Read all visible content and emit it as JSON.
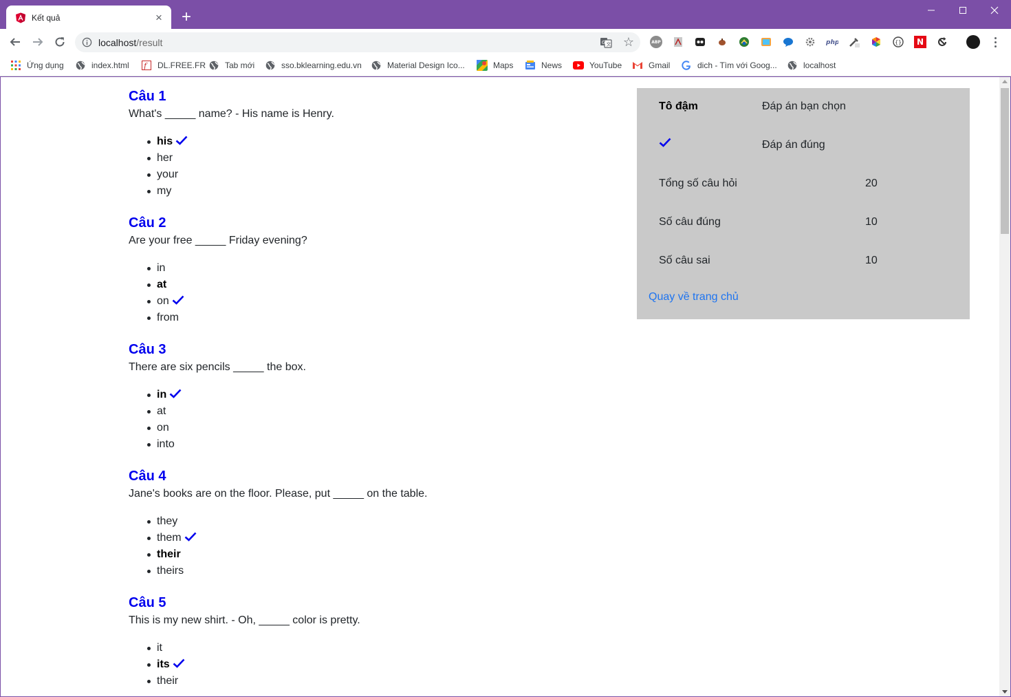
{
  "browser": {
    "tab_title": "Kết quả",
    "url_host": "localhost",
    "url_path": "/result",
    "new_tab_symbol": "+",
    "tab_close_symbol": "×"
  },
  "toolbar_icons": [
    "back-icon",
    "forward-icon",
    "reload-icon",
    "info-icon",
    "translate-icon",
    "star-icon",
    "adblock-icon",
    "pdf-icon",
    "ext-dark-icon",
    "ext-acorn-icon",
    "ext-green-icon",
    "ext-picture-icon",
    "chat-bubble-icon",
    "ext-gear-icon",
    "php-icon",
    "eyedropper-icon",
    "color-wheel-icon",
    "ext-code-icon",
    "ext-n-icon",
    "ext-sync-icon",
    "avatar-icon",
    "menu-icon"
  ],
  "bookmarks": [
    {
      "label": "Ứng dụng",
      "icon": "apps-grid-icon"
    },
    {
      "label": "index.html",
      "icon": "globe-icon"
    },
    {
      "label": "DL.FREE.FR",
      "icon": "flash-icon"
    },
    {
      "label": "Tab mới",
      "icon": "globe-icon"
    },
    {
      "label": "sso.bklearning.edu.vn",
      "icon": "globe-icon"
    },
    {
      "label": "Material Design Ico...",
      "icon": "globe-icon"
    },
    {
      "label": "Maps",
      "icon": "maps-icon"
    },
    {
      "label": "News",
      "icon": "news-icon"
    },
    {
      "label": "YouTube",
      "icon": "youtube-icon"
    },
    {
      "label": "Gmail",
      "icon": "gmail-icon"
    },
    {
      "label": "dich - Tìm với Goog...",
      "icon": "google-icon"
    },
    {
      "label": "localhost",
      "icon": "globe-icon"
    }
  ],
  "questions": [
    {
      "title": "Câu 1",
      "text": "What's _____ name? - His name is Henry.",
      "options": [
        {
          "label": "his",
          "chosen": true,
          "correct": true
        },
        {
          "label": "her",
          "chosen": false,
          "correct": false
        },
        {
          "label": "your",
          "chosen": false,
          "correct": false
        },
        {
          "label": "my",
          "chosen": false,
          "correct": false
        }
      ]
    },
    {
      "title": "Câu 2",
      "text": "Are your free _____ Friday evening?",
      "options": [
        {
          "label": "in",
          "chosen": false,
          "correct": false
        },
        {
          "label": "at",
          "chosen": true,
          "correct": false
        },
        {
          "label": "on",
          "chosen": false,
          "correct": true
        },
        {
          "label": "from",
          "chosen": false,
          "correct": false
        }
      ]
    },
    {
      "title": "Câu 3",
      "text": "There are six pencils _____ the box.",
      "options": [
        {
          "label": "in",
          "chosen": true,
          "correct": true
        },
        {
          "label": "at",
          "chosen": false,
          "correct": false
        },
        {
          "label": "on",
          "chosen": false,
          "correct": false
        },
        {
          "label": "into",
          "chosen": false,
          "correct": false
        }
      ]
    },
    {
      "title": "Câu 4",
      "text": "Jane's books are on the floor. Please, put _____ on the table.",
      "options": [
        {
          "label": "they",
          "chosen": false,
          "correct": false
        },
        {
          "label": "them",
          "chosen": false,
          "correct": true
        },
        {
          "label": "their",
          "chosen": true,
          "correct": false
        },
        {
          "label": "theirs",
          "chosen": false,
          "correct": false
        }
      ]
    },
    {
      "title": "Câu 5",
      "text": "This is my new shirt. - Oh, _____ color is pretty.",
      "options": [
        {
          "label": "it",
          "chosen": false,
          "correct": false
        },
        {
          "label": "its",
          "chosen": true,
          "correct": true
        },
        {
          "label": "their",
          "chosen": false,
          "correct": false
        }
      ]
    }
  ],
  "summary": {
    "legend_bold_label": "Tô đậm",
    "legend_bold_desc": "Đáp án bạn chọn",
    "legend_check_icon": "check-icon",
    "legend_check_desc": "Đáp án đúng",
    "total_label": "Tổng số câu hỏi",
    "total_value": "20",
    "correct_label": "Số câu đúng",
    "correct_value": "10",
    "wrong_label": "Số câu sai",
    "wrong_value": "10",
    "home_link": "Quay về trang chủ"
  },
  "colors": {
    "frame": "#7b4fa7",
    "question_title": "#0000ee",
    "check": "#0000ee",
    "panel_bg": "#c9c9c9",
    "link": "#1e74f0"
  }
}
